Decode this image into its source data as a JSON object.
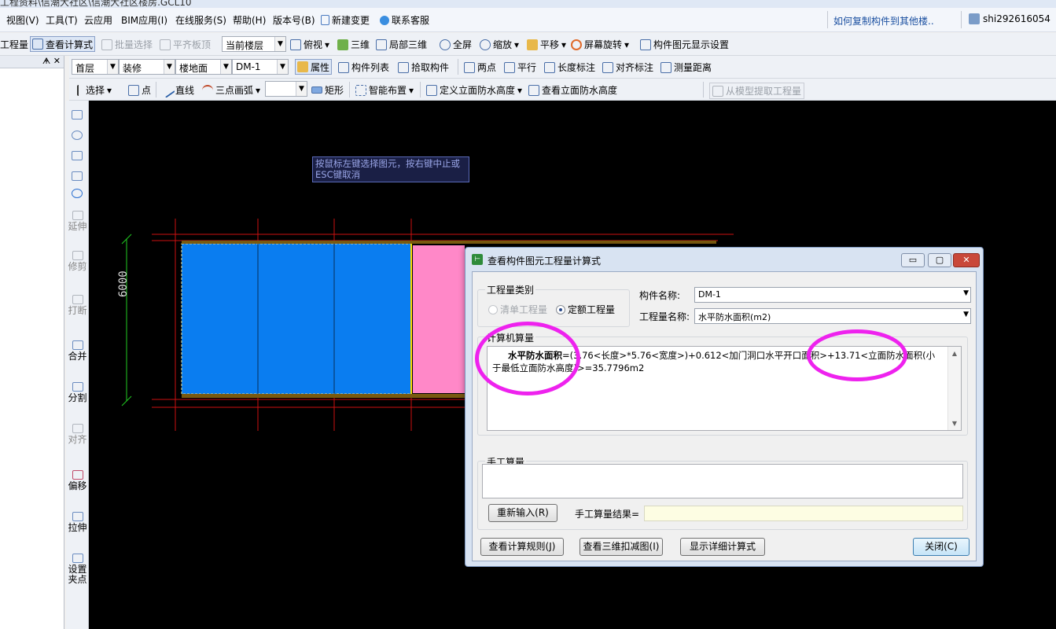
{
  "window": {
    "title": "工程资料\\信潮大社区\\信潮大社区楼房.GCL10"
  },
  "menu": {
    "items": [
      "视图(V)",
      "工具(T)",
      "云应用",
      "BIM应用(I)",
      "在线服务(S)",
      "帮助(H)",
      "版本号(B)",
      "新建变更",
      "联系客服"
    ],
    "hint": "如何复制构件到其他楼..",
    "user": "shi292616054"
  },
  "toolbar1": {
    "items": [
      "工程量",
      "查看计算式",
      "批量选择",
      "平齐板顶",
      "当前楼层",
      "俯视",
      "三维",
      "局部三维",
      "全屏",
      "缩放",
      "平移",
      "屏幕旋转",
      "构件图元显示设置"
    ]
  },
  "toolbar2": {
    "floor": "首层",
    "category": "装修",
    "type": "楼地面",
    "component": "DM-1",
    "items": [
      "属性",
      "构件列表",
      "拾取构件",
      "两点",
      "平行",
      "长度标注",
      "对齐标注",
      "测量距离"
    ]
  },
  "toolbar3": {
    "items": [
      "选择",
      "点",
      "直线",
      "三点画弧",
      "矩形",
      "智能布置",
      "定义立面防水高度",
      "查看立面防水高度",
      "从模型提取工程量"
    ]
  },
  "leftpane": {
    "pin": "ᗗ ✕"
  },
  "sidebar": {
    "items": [
      "延伸",
      "修剪",
      "打断",
      "合并",
      "分割",
      "对齐",
      "偏移",
      "拉伸",
      "设置夹点"
    ]
  },
  "canvas": {
    "tooltip": "按鼠标左键选择图元，按右键中止或ESC键取消",
    "dimension": "6000",
    "colors": {
      "blue_area": "#0a7df0",
      "pink_area": "#ff88c8",
      "grid_line": "#cc1111",
      "dim_line": "#22cc22"
    }
  },
  "dialog": {
    "title": "查看构件图元工程量计算式",
    "category_label": "工程量类别",
    "radio_list": "清单工程量",
    "radio_quota": "定额工程量",
    "component_name_label": "构件名称:",
    "component_name_value": "DM-1",
    "quantity_name_label": "工程量名称:",
    "quantity_name_value": "水平防水面积(m2)",
    "computer_calc_label": "计算机算量",
    "calc_bold": "水平防水面积",
    "calc_text": "=(3.76<长度>*5.76<宽度>)+0.612<加门洞口水平开口面积>+13.71<立面防水面积(小于最低立面防水高度)>=35.7796m2",
    "manual_calc_label": "手工算量",
    "reenter_button": "重新输入(R)",
    "manual_result_label": "手工算量结果=",
    "btn_view_rules": "查看计算规则(J)",
    "btn_view_3d": "查看三维扣减图(I)",
    "btn_show_detail": "显示详细计算式",
    "btn_close": "关闭(C)",
    "annotation_color": "#ee22ee"
  }
}
